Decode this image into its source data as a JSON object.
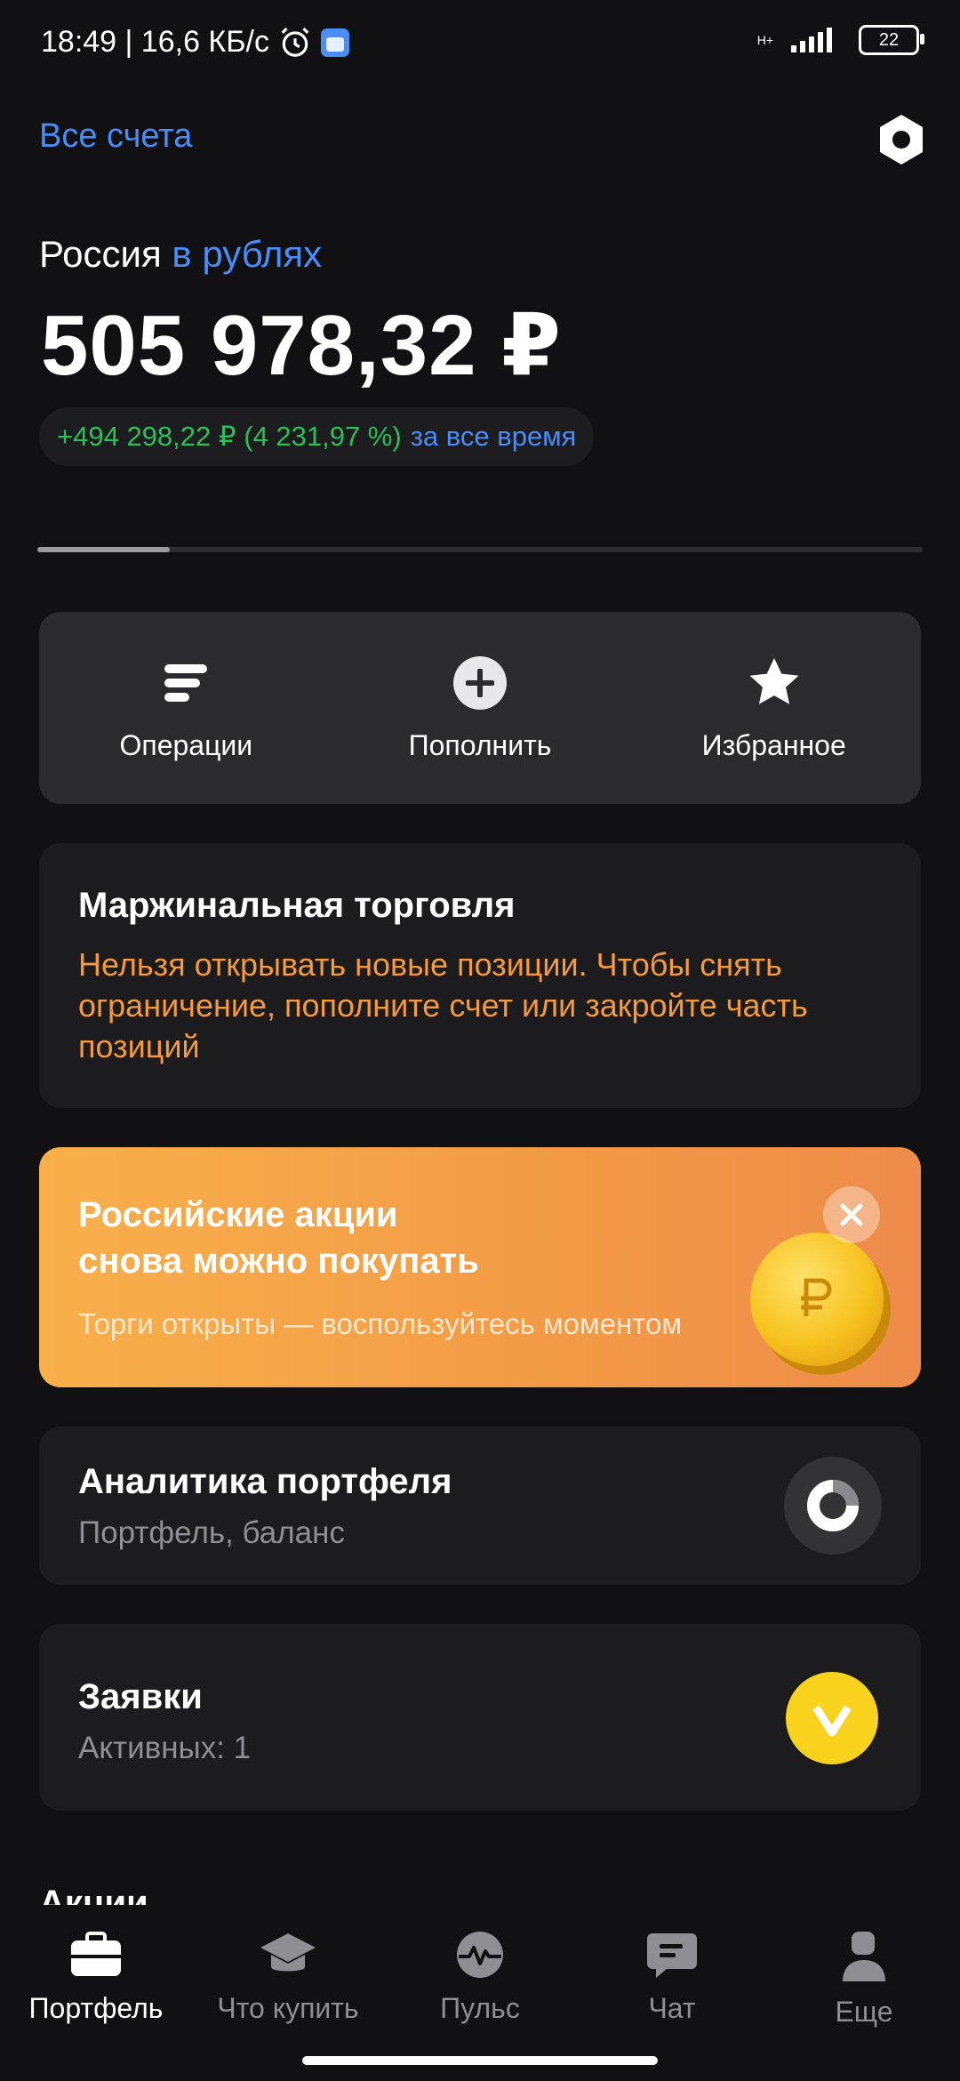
{
  "status_bar": {
    "time_speed": "18:49 | 16,6 КБ/с",
    "network": "H+",
    "battery": "22"
  },
  "header": {
    "all_accounts": "Все счета"
  },
  "portfolio": {
    "region": "Россия",
    "currency": "в рублях",
    "total": "505 978,32 ₽",
    "gain": "+494 298,22 ₽ (4 231,97 %)",
    "period": "за все время",
    "carousel_progress": 0.15
  },
  "actions": [
    {
      "label": "Операции",
      "icon": "operations-icon"
    },
    {
      "label": "Пополнить",
      "icon": "plus-circle-icon"
    },
    {
      "label": "Избранное",
      "icon": "star-icon"
    }
  ],
  "margin_card": {
    "title": "Маржинальная торговля",
    "text": "Нельзя открывать новые позиции. Чтобы снять ограничение, пополните счет или закройте часть позиций"
  },
  "promo": {
    "title_line1": "Российские акции",
    "title_line2": "снова можно покупать",
    "subtitle": "Торги открыты — воспользуйтесь моментом"
  },
  "analytics": {
    "title": "Аналитика портфеля",
    "subtitle": "Портфель, баланс"
  },
  "orders": {
    "title": "Заявки",
    "subtitle": "Активных: 1"
  },
  "next_section": "Акции",
  "bottom_nav": [
    {
      "label": "Портфель",
      "icon": "briefcase-icon",
      "active": true
    },
    {
      "label": "Что купить",
      "icon": "graduation-cap-icon",
      "active": false
    },
    {
      "label": "Пульс",
      "icon": "pulse-icon",
      "active": false
    },
    {
      "label": "Чат",
      "icon": "chat-icon",
      "active": false
    },
    {
      "label": "Еще",
      "icon": "profile-icon",
      "active": false
    }
  ],
  "colors": {
    "background": "#111113",
    "accent_blue": "#4a8cf7",
    "gain_green": "#2cbf59",
    "warning_orange": "#f59a3c",
    "promo_orange": "#f29a46",
    "orders_yellow": "#f8d21c"
  }
}
